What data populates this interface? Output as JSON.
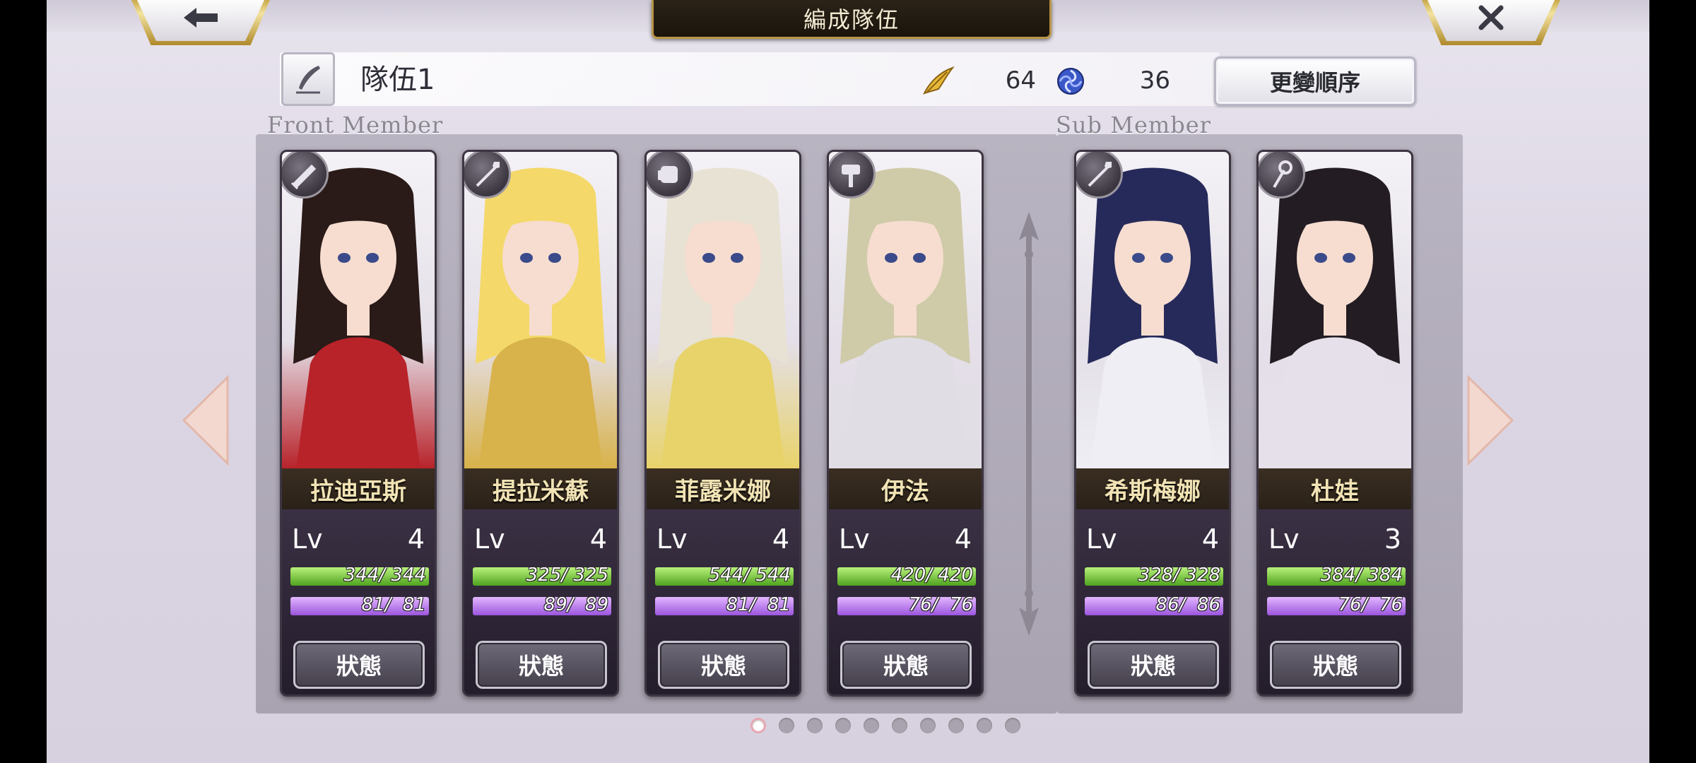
{
  "header": {
    "title": "編成隊伍",
    "back_icon": "arrow-left-icon",
    "close_icon": "close-icon"
  },
  "party": {
    "name": "隊伍1",
    "feather_count": "64",
    "orb_count": "36",
    "reorder_label": "更變順序"
  },
  "sections": {
    "front": "Front Member",
    "sub": "Sub Member"
  },
  "members": [
    {
      "name": "拉迪亞斯",
      "lv_label": "Lv",
      "lv": "4",
      "hp": "344/ 344",
      "mp": "81/  81",
      "status": "狀態",
      "weapon": "sword-icon",
      "color": "#b8232a",
      "hair": "#2a1a18"
    },
    {
      "name": "提拉米蘇",
      "lv_label": "Lv",
      "lv": "4",
      "hp": "325/ 325",
      "mp": "89/  89",
      "status": "狀態",
      "weapon": "spear-icon",
      "color": "#d8b24a",
      "hair": "#f4d86a"
    },
    {
      "name": "菲露米娜",
      "lv_label": "Lv",
      "lv": "4",
      "hp": "544/ 544",
      "mp": "81/  81",
      "status": "狀態",
      "weapon": "gauntlet-icon",
      "color": "#e8d36a",
      "hair": "#e8e2d4"
    },
    {
      "name": "伊法",
      "lv_label": "Lv",
      "lv": "4",
      "hp": "420/ 420",
      "mp": "76/  76",
      "status": "狀態",
      "weapon": "hammer-icon",
      "color": "#e0dde4",
      "hair": "#cfcaa8"
    },
    {
      "name": "希斯梅娜",
      "lv_label": "Lv",
      "lv": "4",
      "hp": "328/ 328",
      "mp": "86/  86",
      "status": "狀態",
      "weapon": "spear-icon",
      "color": "#eeeef4",
      "hair": "#262a5a"
    },
    {
      "name": "杜娃",
      "lv_label": "Lv",
      "lv": "3",
      "hp": "384/ 384",
      "mp": "76/  76",
      "status": "狀態",
      "weapon": "staff-icon",
      "color": "#e6e0ea",
      "hair": "#231c22"
    }
  ],
  "pagination": {
    "pages": 10,
    "current": 1
  }
}
